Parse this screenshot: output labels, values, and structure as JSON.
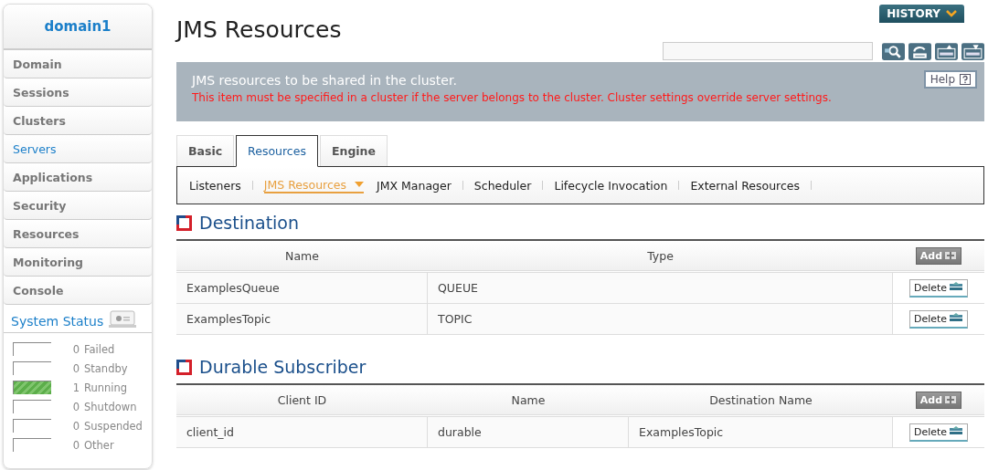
{
  "sidebar": {
    "domain": "domain1",
    "items": [
      {
        "label": "Domain",
        "selected": false
      },
      {
        "label": "Sessions",
        "selected": false
      },
      {
        "label": "Clusters",
        "selected": false
      },
      {
        "label": "Servers",
        "selected": true
      },
      {
        "label": "Applications",
        "selected": false
      },
      {
        "label": "Security",
        "selected": false
      },
      {
        "label": "Resources",
        "selected": false
      },
      {
        "label": "Monitoring",
        "selected": false
      },
      {
        "label": "Console",
        "selected": false
      }
    ],
    "status_title": "System Status",
    "status": [
      {
        "count": "0",
        "label": "Failed",
        "level": 0
      },
      {
        "count": "0",
        "label": "Standby",
        "level": 0
      },
      {
        "count": "1",
        "label": "Running",
        "level": 1
      },
      {
        "count": "0",
        "label": "Shutdown",
        "level": 0
      },
      {
        "count": "0",
        "label": "Suspended",
        "level": 0
      },
      {
        "count": "0",
        "label": "Other",
        "level": 0
      }
    ]
  },
  "title": "JMS Resources",
  "history": "HISTORY",
  "banner": {
    "heading": "JMS resources to be shared in the cluster.",
    "warning": "This item must be specified in a cluster if the server belongs to the cluster. Cluster settings override server settings.",
    "help": "Help"
  },
  "tabs": [
    {
      "label": "Basic",
      "selected": false
    },
    {
      "label": "Resources",
      "selected": true
    },
    {
      "label": "Engine",
      "selected": false
    }
  ],
  "subtabs": [
    {
      "label": "Listeners",
      "selected": false,
      "dropdown": false
    },
    {
      "label": "JMS Resources",
      "selected": true,
      "dropdown": true
    },
    {
      "label": "JMX Manager",
      "selected": false,
      "dropdown": false
    },
    {
      "label": "Scheduler",
      "selected": false,
      "dropdown": false
    },
    {
      "label": "Lifecycle Invocation",
      "selected": false,
      "dropdown": false
    },
    {
      "label": "External Resources",
      "selected": false,
      "dropdown": false
    }
  ],
  "sections": [
    {
      "title": "Destination",
      "columns": [
        "Name",
        "Type"
      ],
      "add": "Add",
      "rows": [
        {
          "cells": [
            "ExamplesQueue",
            "QUEUE"
          ],
          "action": "Delete"
        },
        {
          "cells": [
            "ExamplesTopic",
            "TOPIC"
          ],
          "action": "Delete"
        }
      ]
    },
    {
      "title": "Durable Subscriber",
      "columns": [
        "Client ID",
        "Name",
        "Destination Name"
      ],
      "add": "Add",
      "rows": [
        {
          "cells": [
            "client_id",
            "durable",
            "ExamplesTopic"
          ],
          "action": "Delete"
        }
      ]
    }
  ]
}
